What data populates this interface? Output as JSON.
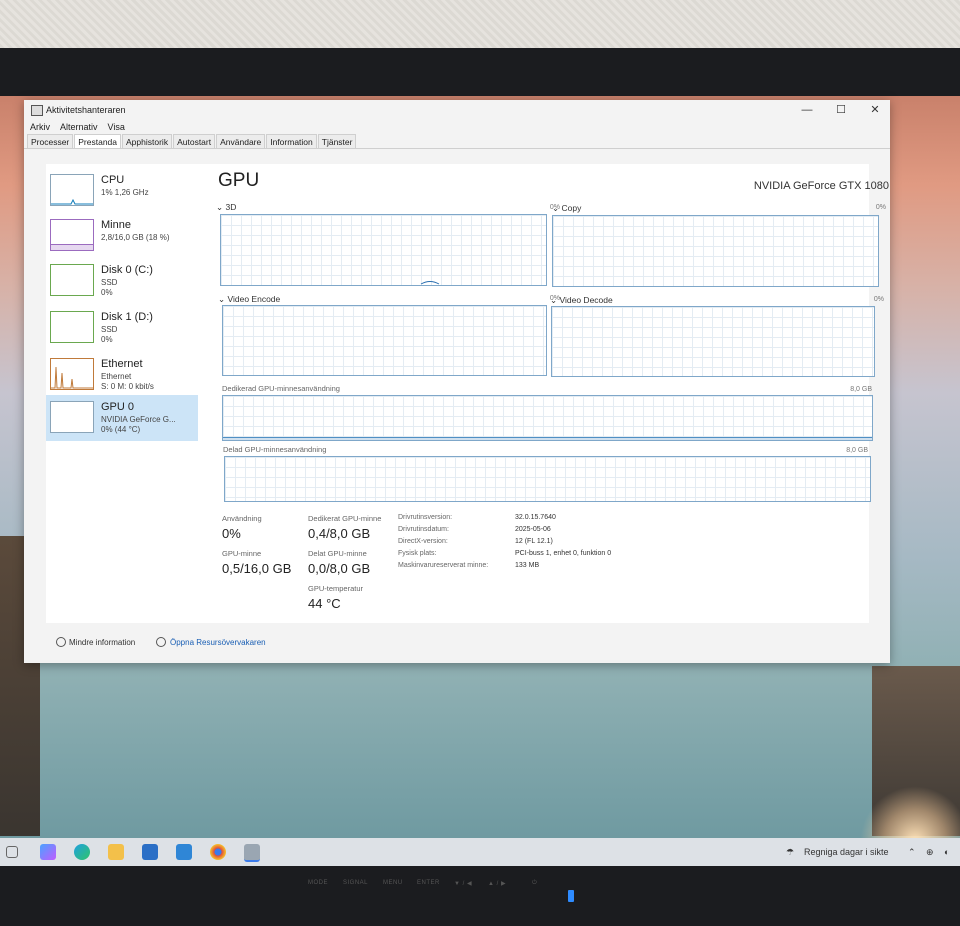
{
  "window": {
    "title": "Aktivitetshanteraren",
    "minimize": "—",
    "maximize": "☐",
    "close": "✕"
  },
  "menu": [
    "Arkiv",
    "Alternativ",
    "Visa"
  ],
  "tabs": [
    "Processer",
    "Prestanda",
    "Apphistorik",
    "Autostart",
    "Användare",
    "Information",
    "Tjänster"
  ],
  "sidebar": [
    {
      "name": "CPU",
      "line1": "1% 1,26 GHz",
      "line2": ""
    },
    {
      "name": "Minne",
      "line1": "2,8/16,0 GB (18 %)",
      "line2": ""
    },
    {
      "name": "Disk 0 (C:)",
      "line1": "SSD",
      "line2": "0%"
    },
    {
      "name": "Disk 1 (D:)",
      "line1": "SSD",
      "line2": "0%"
    },
    {
      "name": "Ethernet",
      "line1": "Ethernet",
      "line2": "S: 0 M: 0 kbit/s"
    },
    {
      "name": "GPU 0",
      "line1": "NVIDIA GeForce G...",
      "line2": "0% (44 °C)"
    }
  ],
  "gpu": {
    "title": "GPU",
    "model": "NVIDIA GeForce GTX 1080",
    "engines": [
      {
        "label": "3D",
        "percent": "0%"
      },
      {
        "label": "Copy",
        "percent": "0%"
      },
      {
        "label": "Video Encode",
        "percent": "0%"
      },
      {
        "label": "Video Decode",
        "percent": "0%"
      }
    ],
    "dedicated_label": "Dedikerad GPU-minnesanvändning",
    "dedicated_max": "8,0 GB",
    "shared_label": "Delad GPU-minnesanvändning",
    "shared_max": "8,0 GB"
  },
  "stats": {
    "usage_label": "Användning",
    "usage_value": "0%",
    "gpu_mem_label": "GPU-minne",
    "gpu_mem_value": "0,5/16,0 GB",
    "ded_label": "Dedikerat GPU-minne",
    "ded_value": "0,4/8,0 GB",
    "shared_label": "Delat GPU-minne",
    "shared_value": "0,0/8,0 GB",
    "temp_label": "GPU-temperatur",
    "temp_value": "44 °C"
  },
  "info": [
    {
      "k": "Drivrutinsversion:",
      "v": "32.0.15.7640"
    },
    {
      "k": "Drivrutinsdatum:",
      "v": "2025-05-06"
    },
    {
      "k": "DirectX-version:",
      "v": "12 (FL 12.1)"
    },
    {
      "k": "Fysisk plats:",
      "v": "PCI-buss 1, enhet 0, funktion 0"
    },
    {
      "k": "Maskinvarureserverat minne:",
      "v": "133 MB"
    }
  ],
  "footer": {
    "less": "Mindre information",
    "resmon": "Öppna Resursövervakaren"
  },
  "taskbar": {
    "weather": "Regniga dagar i sikte"
  },
  "monitor_osd": [
    "MODE",
    "SIGNAL",
    "MENU",
    "ENTER",
    "▼ / ◀",
    "▲ / ▶",
    "⏻"
  ],
  "colors": {
    "accent": "#cce4f7",
    "graph_border": "#7fa7c9",
    "link": "#1a5fb4"
  }
}
